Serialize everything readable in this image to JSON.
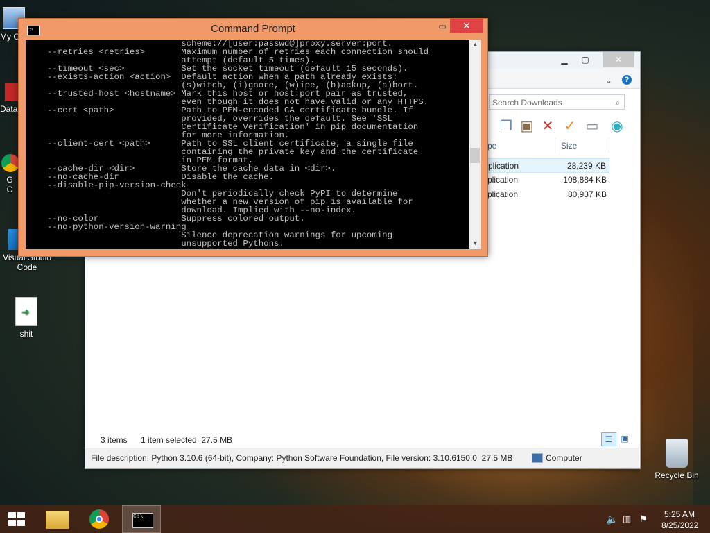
{
  "desktop": {
    "icons": [
      {
        "label": "My C"
      },
      {
        "label": "Data"
      },
      {
        "label": "G C"
      },
      {
        "label": "Visual Studio Code"
      },
      {
        "label": "shit"
      },
      {
        "label": "Recycle Bin"
      }
    ]
  },
  "cmd_window": {
    "title": "Command Prompt",
    "min_glyph": "▭",
    "max_glyph": "▭",
    "close_glyph": "✕",
    "lines": [
      "                            scheme://[user:passwd@]proxy.server:port.",
      "  --retries <retries>       Maximum number of retries each connection should",
      "                            attempt (default 5 times).",
      "  --timeout <sec>           Set the socket timeout (default 15 seconds).",
      "  --exists-action <action>  Default action when a path already exists:",
      "                            (s)witch, (i)gnore, (w)ipe, (b)ackup, (a)bort.",
      "  --trusted-host <hostname> Mark this host or host:port pair as trusted,",
      "                            even though it does not have valid or any HTTPS.",
      "  --cert <path>             Path to PEM-encoded CA certificate bundle. If",
      "                            provided, overrides the default. See 'SSL",
      "                            Certificate Verification' in pip documentation",
      "                            for more information.",
      "  --client-cert <path>      Path to SSL client certificate, a single file",
      "                            containing the private key and the certificate",
      "                            in PEM format.",
      "  --cache-dir <dir>         Store the cache data in <dir>.",
      "  --no-cache-dir            Disable the cache.",
      "  --disable-pip-version-check",
      "                            Don't periodically check PyPI to determine",
      "                            whether a new version of pip is available for",
      "                            download. Implied with --no-index.",
      "  --no-color                Suppress colored output.",
      "  --no-python-version-warning",
      "                            Silence deprecation warnings for upcoming",
      "                            unsupported Pythons."
    ]
  },
  "explorer": {
    "search_placeholder": "Search Downloads",
    "columns": {
      "type": "pe",
      "size": "Size"
    },
    "files": [
      {
        "type": "plication",
        "size": "28,239 KB"
      },
      {
        "type": "plication",
        "size": "108,884 KB"
      },
      {
        "type": "plication",
        "size": "80,937 KB"
      }
    ],
    "status": {
      "items": "3 items",
      "selected": "1 item selected  27.5 MB"
    },
    "details": {
      "description": "File description: Python 3.10.6 (64-bit), Company: Python Software Foundation, File version: 3.10.6150.0  27.5 MB",
      "location": "Computer"
    }
  },
  "taskbar": {
    "time": "5:25 AM",
    "date": "8/25/2022"
  },
  "colors": {
    "cmd_frame": "#f09a6a",
    "cmd_close": "#e04343",
    "console_bg": "#000000",
    "console_fg": "#c0c0c0"
  }
}
